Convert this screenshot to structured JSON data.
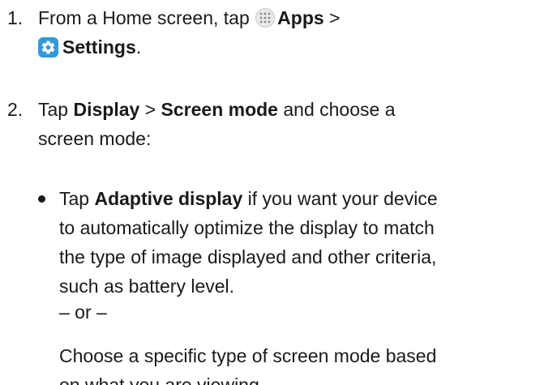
{
  "step1": {
    "number": "1.",
    "prefix": "From a Home screen, tap",
    "apps_label": "Apps",
    "separator": ">",
    "settings_label": "Settings",
    "period": ".",
    "apps_icon": "apps-grid-icon",
    "settings_icon": "gear-icon",
    "settings_icon_color": "#2f9ae0"
  },
  "step2": {
    "number": "2.",
    "tap": "Tap",
    "display_label": "Display",
    "separator": ">",
    "screen_mode_label": "Screen mode",
    "suffix": "and choose a",
    "line2": "screen mode:"
  },
  "bullet": {
    "tap": "Tap",
    "adaptive_label": "Adaptive display",
    "line1_rest": "if you want your device",
    "line2": "to automatically optimize the display to match",
    "line3": "the type of image displayed and other criteria,",
    "line4": "such as battery level."
  },
  "or_text": "– or –",
  "alternative": {
    "line1": "Choose a specific type of screen mode based",
    "line2": "on what you are viewing."
  }
}
